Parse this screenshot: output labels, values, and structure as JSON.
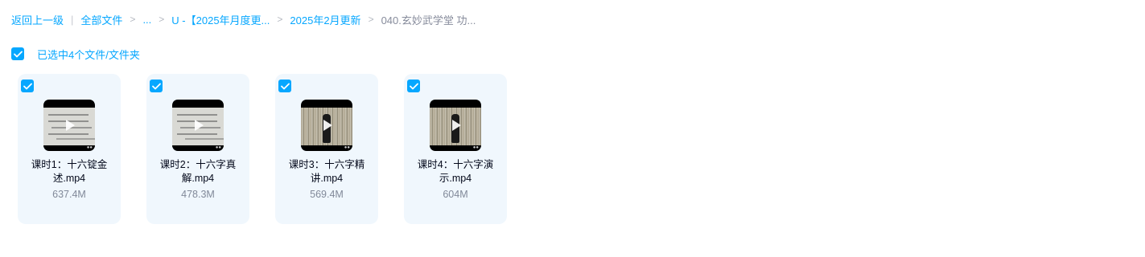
{
  "breadcrumb": {
    "back": "返回上一级",
    "root": "全部文件",
    "ellipsis": "...",
    "folder1": "U -【2025年月度更...",
    "folder2": "2025年2月更新",
    "current": "040.玄妙武学堂 功...",
    "separator": ">",
    "pipe": "|"
  },
  "selection": {
    "label": "已选中4个文件/文件夹",
    "checked": true
  },
  "colors": {
    "accent": "#06a7ff",
    "card_bg": "#f0f7fd",
    "text": "#03081a",
    "muted": "#818999"
  },
  "files": [
    {
      "name": "课时1：十六锭金述.mp4",
      "size": "637.4M",
      "checked": true,
      "thumb_icon": "video-thumbnail-whiteboard"
    },
    {
      "name": "课时2：十六字真解.mp4",
      "size": "478.3M",
      "checked": true,
      "thumb_icon": "video-thumbnail-whiteboard"
    },
    {
      "name": "课时3：十六字精讲.mp4",
      "size": "569.4M",
      "checked": true,
      "thumb_icon": "video-thumbnail-curtain"
    },
    {
      "name": "课时4：十六字演示.mp4",
      "size": "604M",
      "checked": true,
      "thumb_icon": "video-thumbnail-curtain"
    }
  ]
}
